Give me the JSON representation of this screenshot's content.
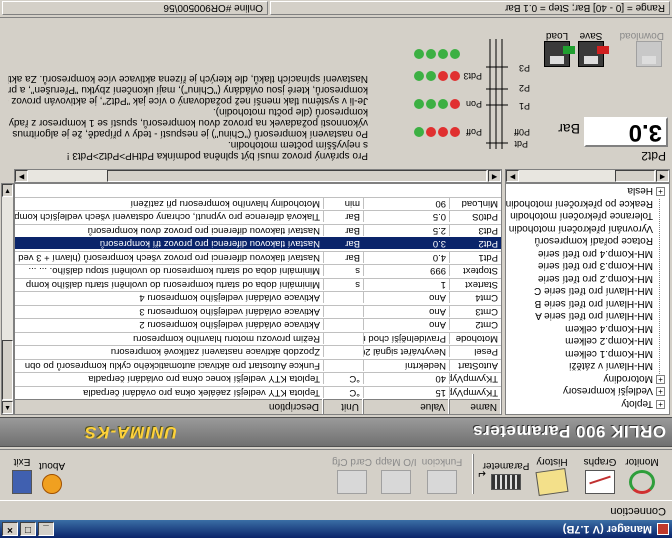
{
  "window": {
    "title": "Manager (V 1.7B)"
  },
  "menu": {
    "items": [
      "Connection"
    ]
  },
  "toolbar": {
    "monitor": "Monitor",
    "graphs": "Graphs",
    "history": "History",
    "parameter": "Parameter",
    "funkcion": "Funkcion",
    "io_mapp": "I/O Mapp",
    "card_cfg": "Card Cfg",
    "about": "About",
    "exit": "Exit"
  },
  "banner": {
    "title": "ORLIK 900 Parameters",
    "logo": "UNIMA-KS"
  },
  "tree": {
    "items": [
      {
        "label": "Teploty",
        "toggle": "+"
      },
      {
        "label": "Vedlejší kompresory",
        "toggle": "+"
      },
      {
        "label": "Motorodiny",
        "toggle": "+"
      },
      {
        "label": "MH-Hlavní v zátěži"
      },
      {
        "label": "MH-Komp.1 celkem"
      },
      {
        "label": "MH-Komp.2 celkem"
      },
      {
        "label": "MH-Komp.4 celkem"
      },
      {
        "label": "MH-Hlavní pro třetí serie A"
      },
      {
        "label": "MH-Hlavní pro třetí serie B"
      },
      {
        "label": "MH-Hlavní pro třetí serie C"
      },
      {
        "label": "MH-Komp.2 pro třetí serie"
      },
      {
        "label": "MH-Komp.3 pro třetí serie"
      },
      {
        "label": "MH-Komp.4 pro třetí serie"
      },
      {
        "label": "Rotace pořadí kompresorů"
      },
      {
        "label": "Vyrovnání překročení motohodin"
      },
      {
        "label": "Tolerance překročení motohodin"
      },
      {
        "label": "Reakce po překročení motohodin"
      },
      {
        "label": "Hesla",
        "toggle": "+"
      }
    ]
  },
  "grid": {
    "columns": [
      "Name",
      "Value",
      "Unit",
      "Description"
    ],
    "rows": [
      {
        "name": "TKyvmpVyp",
        "value": "15",
        "unit": "°C",
        "desc": "Teplota KTY vedlejší zaéálek okna pro ovádání čerpadla"
      },
      {
        "name": "TKyvmpVyp",
        "value": "40",
        "unit": "°C",
        "desc": "Teplota KTY vedlejší konec okna pro ovládání čerpadla"
      },
      {
        "name": "AutoStart",
        "value": "Nedekrtní",
        "unit": "",
        "desc": "Funkce Autostart pro aktivaci automatického cyklu kompresorů po obn"
      },
      {
        "name": "Pesel",
        "value": "Nevytvářet signál 20mA",
        "unit": "",
        "desc": "Zpozdob aktivace nastavení zatíkové kompresoru"
      },
      {
        "name": "Motohode",
        "value": "Pravidelnější chod motoru",
        "unit": "",
        "desc": "Režim provozu motoru hlavního kompresoru"
      },
      {
        "name": "Cmt2",
        "value": "Ano",
        "unit": "",
        "desc": "Aktivace ovládání vedlejšího kompresoru 2"
      },
      {
        "name": "Cmt3",
        "value": "Ano",
        "unit": "",
        "desc": "Aktivace ovládání vedlejšího kompresoru 3"
      },
      {
        "name": "Cmt4",
        "value": "Ano",
        "unit": "",
        "desc": "Aktivace ovládání vedlejšího kompresoru 4"
      },
      {
        "name": "Startext",
        "value": "1",
        "unit": "s",
        "desc": "Minimální doba od startu kompresoru do uvolnění startu dalšího komp"
      },
      {
        "name": "Stoptext",
        "value": "999",
        "unit": "s",
        "desc": "Minimální doba od startu kompresoru do uvolnění stopu dalšího. ... ..."
      },
      {
        "name": "Pdt1",
        "value": "4.0",
        "unit": "Bar",
        "desc": "Nastaví tlakovou diferenci pro provoz všech kompresorů (hlavní + 3 ved"
      },
      {
        "name": "Pdt2",
        "value": "3.0",
        "unit": "Bar",
        "desc": "Nastaví tlakovou diferenci pro provoz tří kompresorů",
        "selected": true
      },
      {
        "name": "Pdt3",
        "value": "2.5",
        "unit": "Bar",
        "desc": "Nastaví tlakovou diferenci pro provoz dvou kompresorů"
      },
      {
        "name": "Pdt0S",
        "value": "0.5",
        "unit": "Bar",
        "desc": "Tlaková diference pro vypnutí, ochrany odstavení všech vedlejších kompres"
      },
      {
        "name": "MinLoad",
        "value": "90",
        "unit": "min",
        "desc": "Motohodiny hlavního kompresoru při zatížení"
      }
    ]
  },
  "detail": {
    "param_name": "Pdt2",
    "value": "3.0",
    "unit": "Bar",
    "gauge_labels": {
      "pdt": "Pdt",
      "p0ff": "P0ff",
      "p1": "P1",
      "p2": "P2",
      "p3": "P3",
      "pon": "Pon"
    },
    "row_labels": {
      "poff_row": "Poff",
      "pon_row": "Pon",
      "pdt3_row": "Pdt3"
    },
    "desc_lines": [
      "Pro správný provoz musí být splněna podmínka PdtHP>Pdt2>Pdt3 !",
      "s nejvyšším počtem motohodin.",
      "Po nastavení kompresorů (\"Chinu\") je nespustí - tedy v případě, že je algoritmus",
      "výkonnosti požadavek na provoz dvou kompresorů, spustí se 1 kompresor z řady",
      "kompresorů (dle počtu motohodin).",
      "Je-li v systému tlak menší než požadovaný o více jak \"Pdt2\", je aktivován provoz celkem tří",
      "kompresorů, které jsou ovládány (\"Chinu\"), mají ukončení zbytku \"Přerušen\", a proto se",
      "Nastavení spínacích tlaků, dle kterých je řízena aktivace více kompresorů. Za aktivaci v"
    ]
  },
  "io": {
    "load": "Load",
    "save": "Save",
    "download": "Download"
  },
  "status": {
    "left": "Online #OR900500\\56",
    "right": "Range = [0 - 40] Bar; Step = 0.1 Bar"
  }
}
